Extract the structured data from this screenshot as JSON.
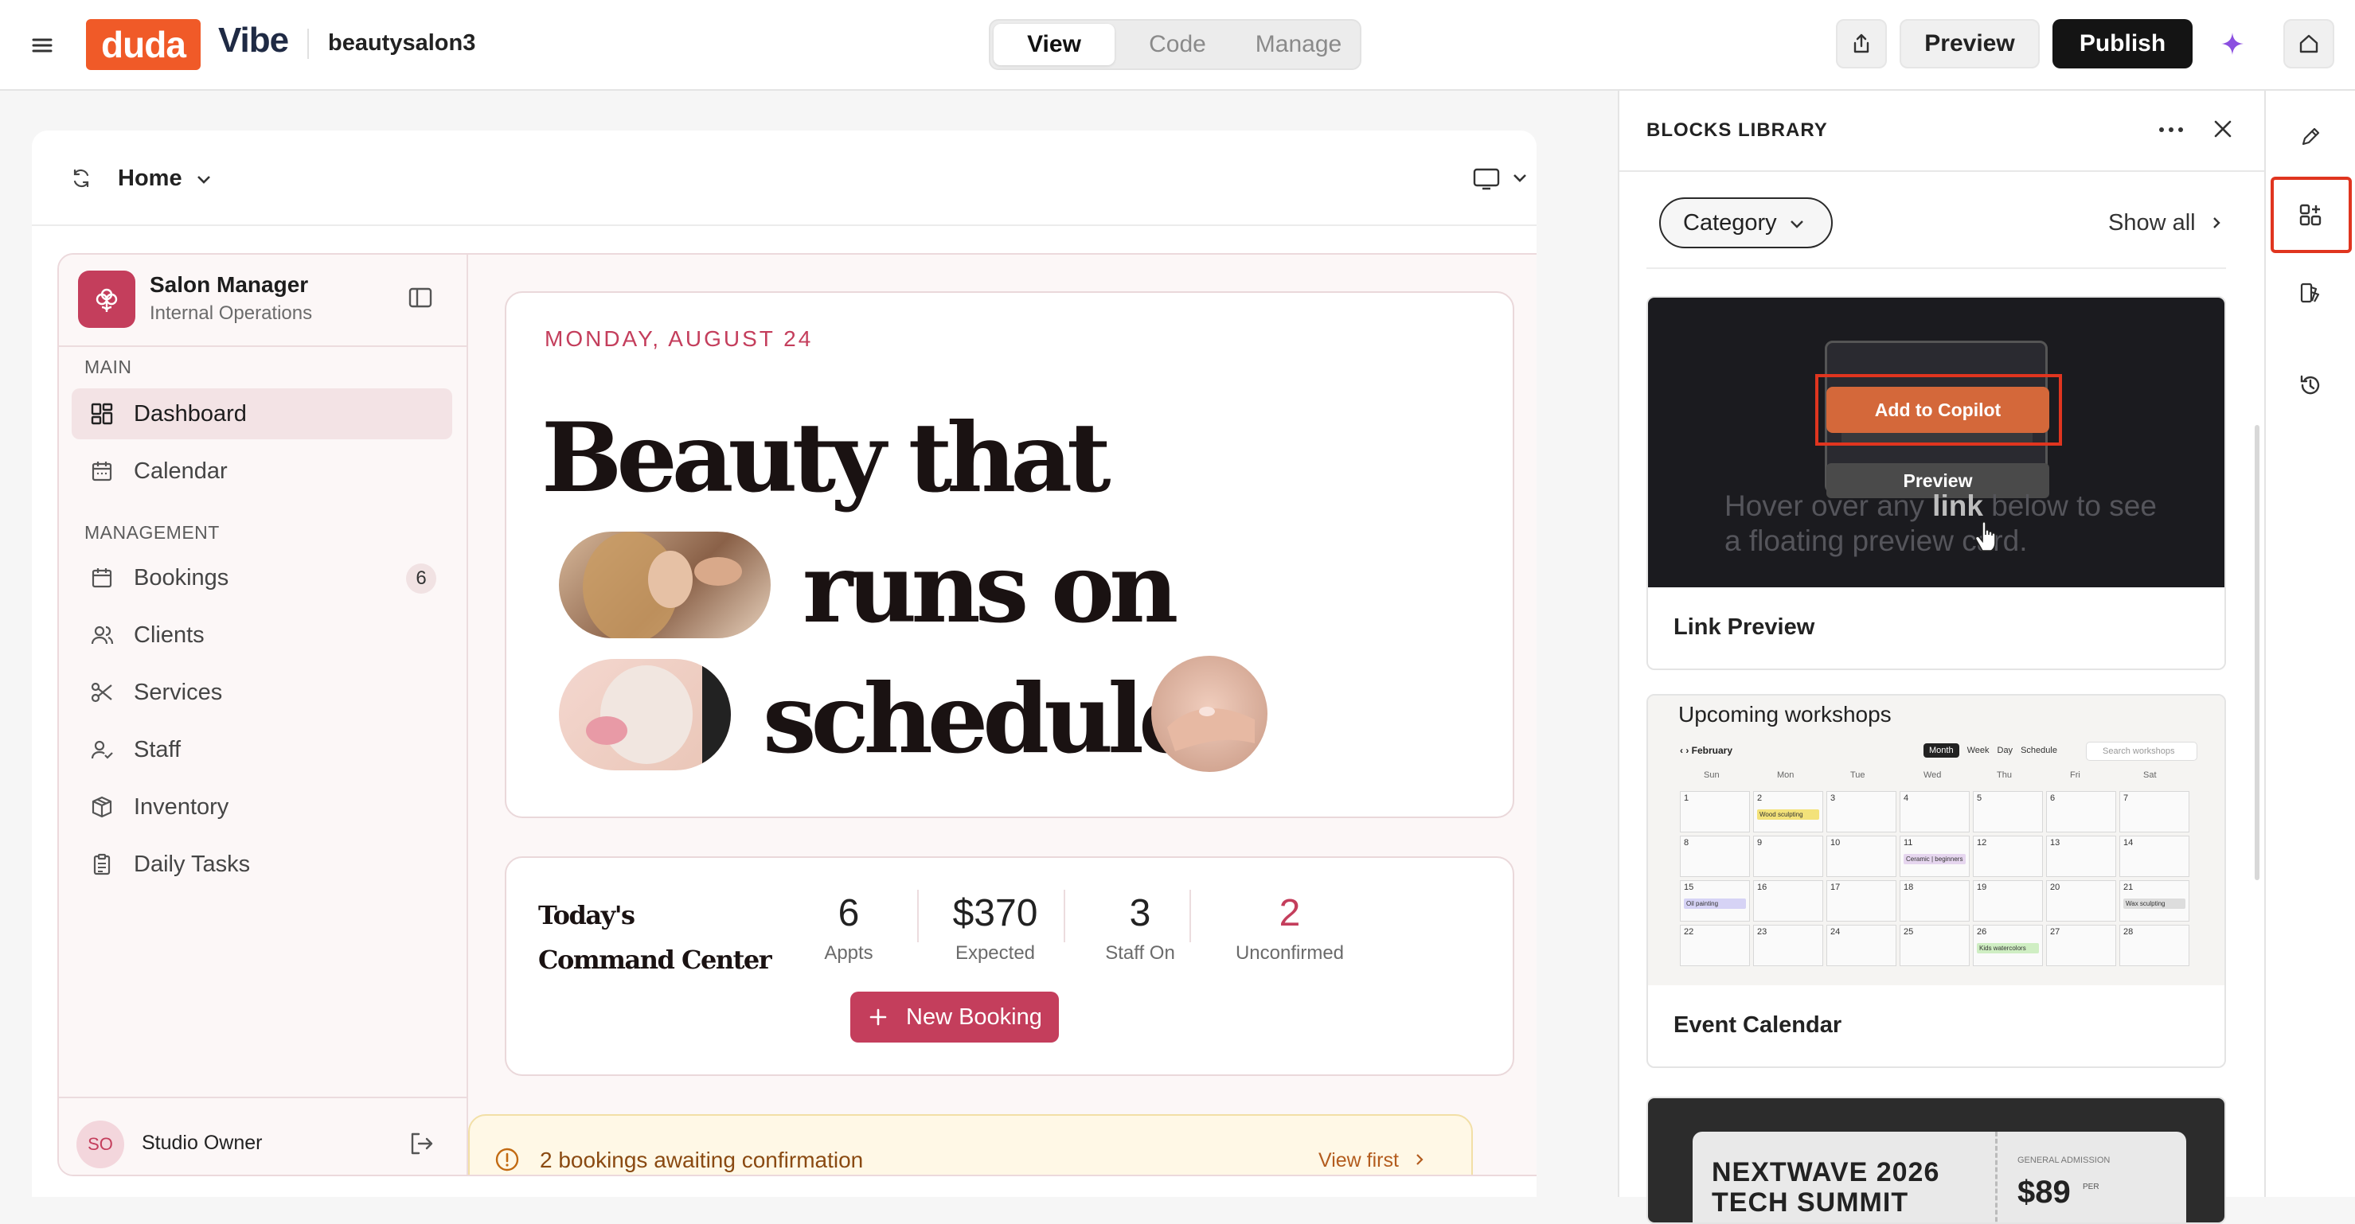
{
  "topbar": {
    "brand": "duda",
    "product": "Vibe",
    "site_name": "beautysalon3",
    "tabs": [
      "View",
      "Code",
      "Manage"
    ],
    "active_tab": "View",
    "preview_label": "Preview",
    "publish_label": "Publish"
  },
  "canvas": {
    "page_selector": "Home"
  },
  "app": {
    "brand_title": "Salon Manager",
    "brand_subtitle": "Internal Operations",
    "section_main": "MAIN",
    "section_management": "MANAGEMENT",
    "nav": [
      {
        "label": "Dashboard",
        "icon": "dashboard-icon",
        "active": true
      },
      {
        "label": "Calendar",
        "icon": "calendar-icon"
      },
      {
        "label": "Bookings",
        "icon": "bookings-icon",
        "badge": "6"
      },
      {
        "label": "Clients",
        "icon": "clients-icon"
      },
      {
        "label": "Services",
        "icon": "scissors-icon"
      },
      {
        "label": "Staff",
        "icon": "staff-icon"
      },
      {
        "label": "Inventory",
        "icon": "box-icon"
      },
      {
        "label": "Daily Tasks",
        "icon": "clipboard-icon"
      }
    ],
    "user_initials": "SO",
    "user_name": "Studio Owner",
    "hero": {
      "date": "MONDAY, AUGUST 24",
      "line1": "Beauty that",
      "line2": "runs on",
      "line3": "schedule"
    },
    "command_center": {
      "title": "Today's Command Center",
      "stats": [
        {
          "value": "6",
          "label": "Appts"
        },
        {
          "value": "$370",
          "label": "Expected"
        },
        {
          "value": "3",
          "label": "Staff On"
        },
        {
          "value": "2",
          "label": "Unconfirmed"
        }
      ],
      "new_booking": "New Booking"
    },
    "alert": {
      "text": "2 bookings awaiting confirmation",
      "action": "View first"
    }
  },
  "panel": {
    "title": "BLOCKS LIBRARY",
    "category_label": "Category",
    "show_all": "Show all",
    "cards": [
      {
        "title": "Link Preview",
        "overlay_button": "Add to Copilot",
        "overlay_preview": "Preview",
        "thumb_text_a": "Hover over any",
        "thumb_text_b": "link",
        "thumb_text_c": "below to see",
        "thumb_text_d": "a floating preview card."
      },
      {
        "title": "Event Calendar",
        "thumb_heading": "Upcoming workshops",
        "month": "February",
        "views": [
          "Month",
          "Week",
          "Day",
          "Schedule"
        ],
        "search_placeholder": "Search workshops",
        "weekdays": [
          "Sun",
          "Mon",
          "Tue",
          "Wed",
          "Thu",
          "Fri",
          "Sat"
        ],
        "events": [
          "Wood sculpting",
          "Ceramic | beginners",
          "Oil painting",
          "Wax sculpting",
          "Kids watercolors"
        ]
      },
      {
        "thumb_heading": "NEXTWAVE 2026",
        "thumb_sub": "TECH SUMMIT",
        "ticket_label": "GENERAL ADMISSION",
        "price": "$89",
        "per": "PER"
      }
    ]
  },
  "colors": {
    "duda_orange": "#f05a28",
    "accent_rose": "#c43e5c",
    "highlight_red": "#e0351f"
  }
}
